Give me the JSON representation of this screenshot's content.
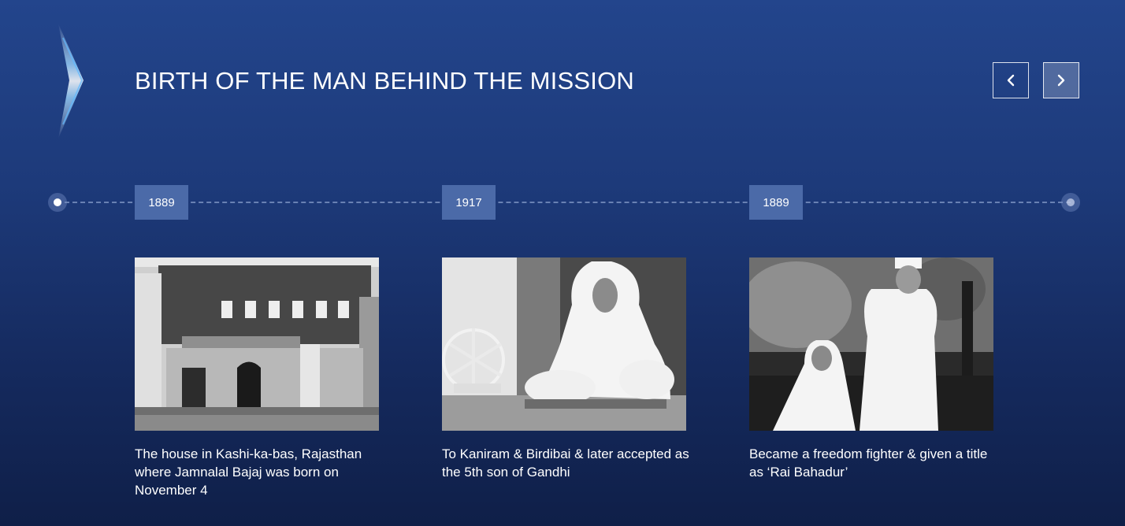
{
  "header": {
    "title": "BIRTH OF THE MAN BEHIND THE MISSION",
    "logo_icon": "chevron-right-glow-icon",
    "prev_icon": "chevron-left-icon",
    "next_icon": "chevron-right-icon"
  },
  "timeline": {
    "items": [
      {
        "year": "1889",
        "caption": "The house in Kashi-ka-bas, Rajasthan where Jamnalal Bajaj was born on November 4",
        "photo": "old-house-photo"
      },
      {
        "year": "1917",
        "caption": "To Kaniram & Birdibai & later accepted as the 5th son of Gandhi",
        "photo": "woman-spinning-wheel-photo"
      },
      {
        "year": "1889",
        "caption": "Became a freedom fighter & given a title as ‘Rai Bahadur’",
        "photo": "couple-portrait-photo"
      }
    ]
  },
  "colors": {
    "background_top": "#23458c",
    "background_bottom": "#0f1f48",
    "year_badge": "#4b6aa8",
    "accent_glow": "#6fc3ff"
  }
}
